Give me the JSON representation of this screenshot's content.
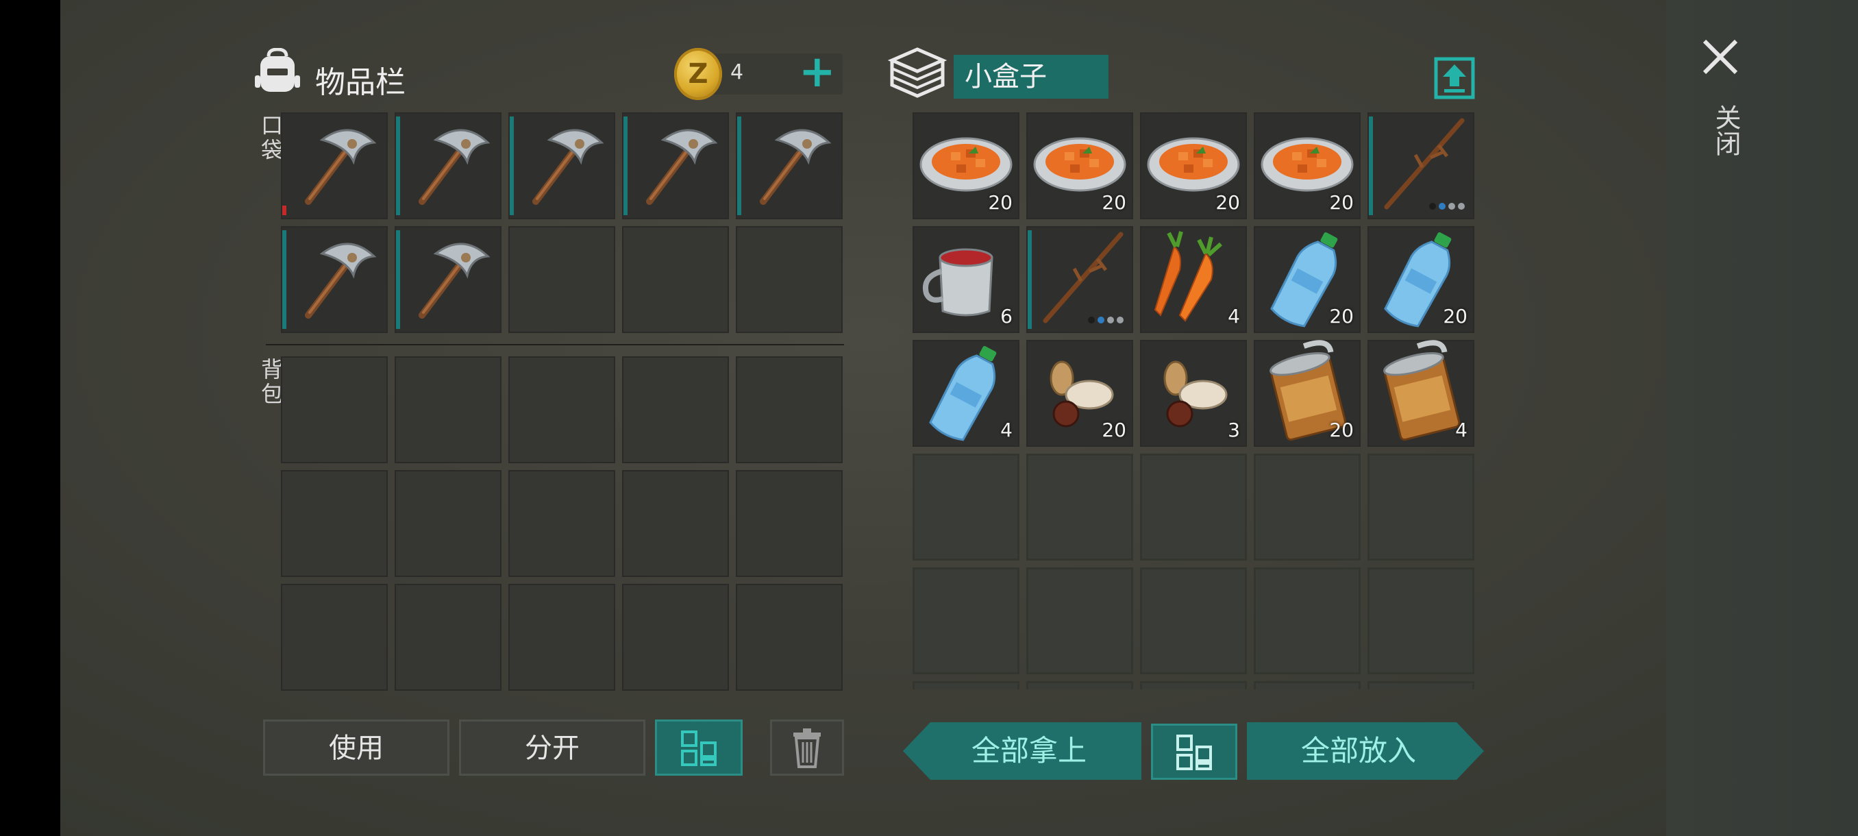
{
  "inventory": {
    "title": "物品栏",
    "coins": "4",
    "pocket_label": "口袋",
    "backpack_label": "背包",
    "pocket_slots": [
      {
        "item": "pickaxe-icon",
        "durability": "low"
      },
      {
        "item": "pickaxe-icon",
        "durability": "full"
      },
      {
        "item": "pickaxe-icon",
        "durability": "full"
      },
      {
        "item": "pickaxe-icon",
        "durability": "full"
      },
      {
        "item": "pickaxe-icon",
        "durability": "full"
      },
      {
        "item": "pickaxe-icon",
        "durability": "full"
      },
      {
        "item": "pickaxe-icon",
        "durability": "full"
      },
      {
        "item": ""
      },
      {
        "item": ""
      },
      {
        "item": ""
      }
    ],
    "buttons": {
      "use": "使用",
      "split": "分开"
    }
  },
  "container": {
    "name": "小盒子",
    "slots": [
      {
        "item": "stew-bowl-icon",
        "qty": "20"
      },
      {
        "item": "stew-bowl-icon",
        "qty": "20"
      },
      {
        "item": "stew-bowl-icon",
        "qty": "20"
      },
      {
        "item": "stew-bowl-icon",
        "qty": "20"
      },
      {
        "item": "wooden-spear-icon",
        "qty": ""
      },
      {
        "item": "tea-mug-icon",
        "qty": "6"
      },
      {
        "item": "wooden-spear-icon",
        "qty": ""
      },
      {
        "item": "carrots-icon",
        "qty": "4"
      },
      {
        "item": "water-bottle-icon",
        "qty": "20"
      },
      {
        "item": "water-bottle-icon",
        "qty": "20"
      },
      {
        "item": "water-bottle-icon",
        "qty": "4"
      },
      {
        "item": "seeds-icon",
        "qty": "20"
      },
      {
        "item": "seeds-icon",
        "qty": "3"
      },
      {
        "item": "canned-food-icon",
        "qty": "20"
      },
      {
        "item": "canned-food-icon",
        "qty": "4"
      }
    ],
    "buttons": {
      "take_all": "全部拿上",
      "put_all": "全部放入"
    }
  },
  "close_label": "关闭",
  "colors": {
    "accent": "#23b3a9",
    "teal_dark": "#1f6b66",
    "durability": "#197a77",
    "low": "#c42a2a"
  }
}
